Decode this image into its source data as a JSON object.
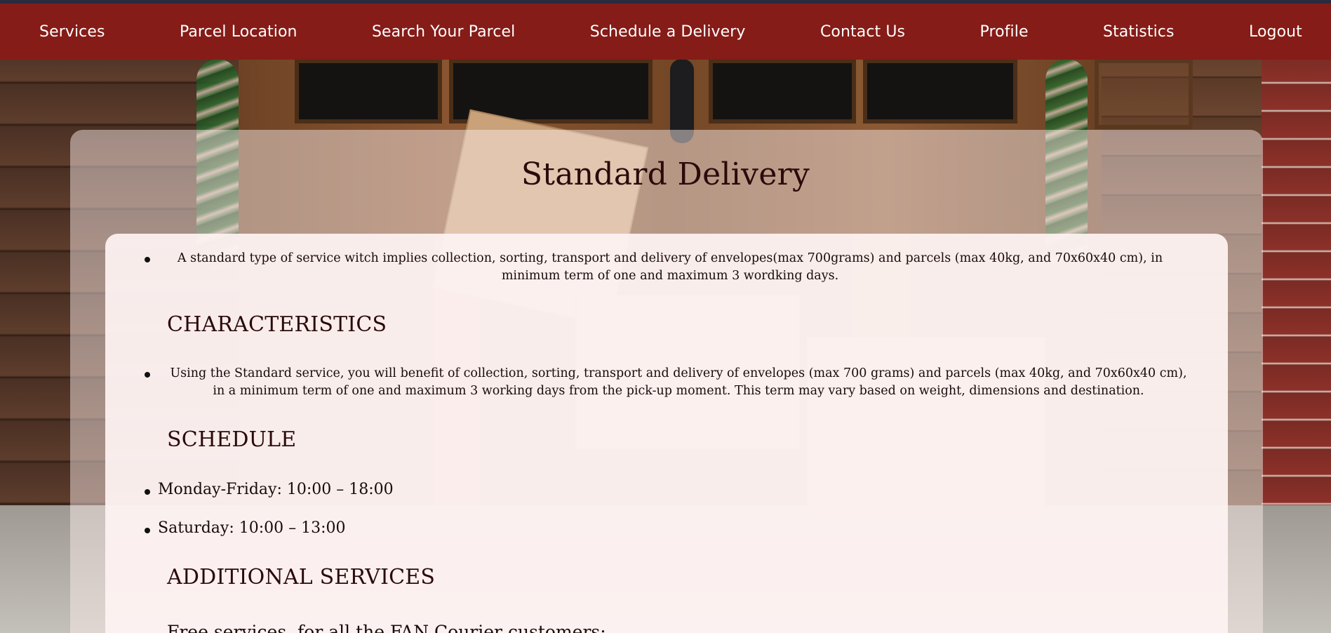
{
  "nav": {
    "items": [
      "Services",
      "Parcel Location",
      "Search Your Parcel",
      "Schedule a Delivery",
      "Contact Us",
      "Profile",
      "Statistics",
      "Logout"
    ]
  },
  "colors": {
    "nav_bg": "#851c17",
    "top_line": "#2b2b3d",
    "text_dark": "#2a0a0a"
  },
  "page": {
    "title": "Standard Delivery",
    "intro": "A standard type of service witch implies collection, sorting, transport and delivery of envelopes(max 700grams) and parcels (max 40kg, and 70x60x40 cm), in minimum term of one and maximum 3 wordking days.",
    "sections": {
      "characteristics": {
        "heading": "CHARACTERISTICS",
        "text": "Using the Standard service, you will benefit of collection, sorting, transport and delivery of envelopes (max 700 grams) and parcels (max 40kg, and 70x60x40 cm), in a minimum term of one and maximum 3 working days from the pick-up moment. This term may vary based on weight, dimensions and destination."
      },
      "schedule": {
        "heading": "SCHEDULE",
        "items": [
          "Monday-Friday: 10:00 – 18:00",
          "Saturday: 10:00 – 13:00"
        ]
      },
      "additional": {
        "heading": "ADDITIONAL SERVICES",
        "text": "Free services, for all the FAN Courier customers:"
      }
    }
  }
}
